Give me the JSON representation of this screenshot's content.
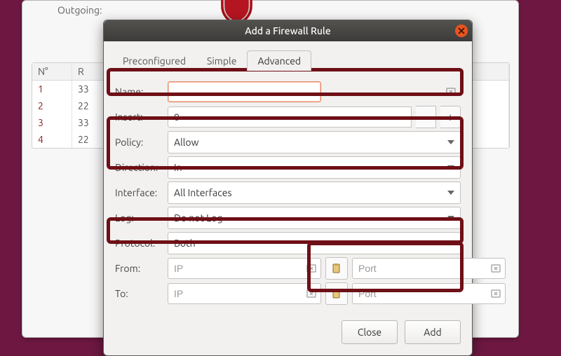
{
  "background": {
    "outgoing_label": "Outgoing:",
    "table": {
      "headers": [
        "N°",
        "R"
      ],
      "rows": [
        {
          "n": "1",
          "r": "33"
        },
        {
          "n": "2",
          "r": "22"
        },
        {
          "n": "3",
          "r": "33"
        },
        {
          "n": "4",
          "r": "22"
        }
      ]
    }
  },
  "dialog": {
    "title": "Add a Firewall Rule",
    "tabs": {
      "preconfigured": "Preconfigured",
      "simple": "Simple",
      "advanced": "Advanced"
    },
    "fields": {
      "name_label": "Name:",
      "name_value": "",
      "insert_label": "Insert:",
      "insert_value": "0",
      "policy_label": "Policy:",
      "policy_value": "Allow",
      "direction_label": "Direction:",
      "direction_value": "In",
      "interface_label": "Interface:",
      "interface_value": "All Interfaces",
      "log_label": "Log:",
      "log_value": "Do not Log",
      "protocol_label": "Protocol:",
      "protocol_value": "Both",
      "from_label": "From:",
      "from_ip_placeholder": "IP",
      "from_port_placeholder": "Port",
      "to_label": "To:",
      "to_ip_placeholder": "IP",
      "to_port_placeholder": "Port"
    },
    "buttons": {
      "close": "Close",
      "add": "Add"
    }
  }
}
